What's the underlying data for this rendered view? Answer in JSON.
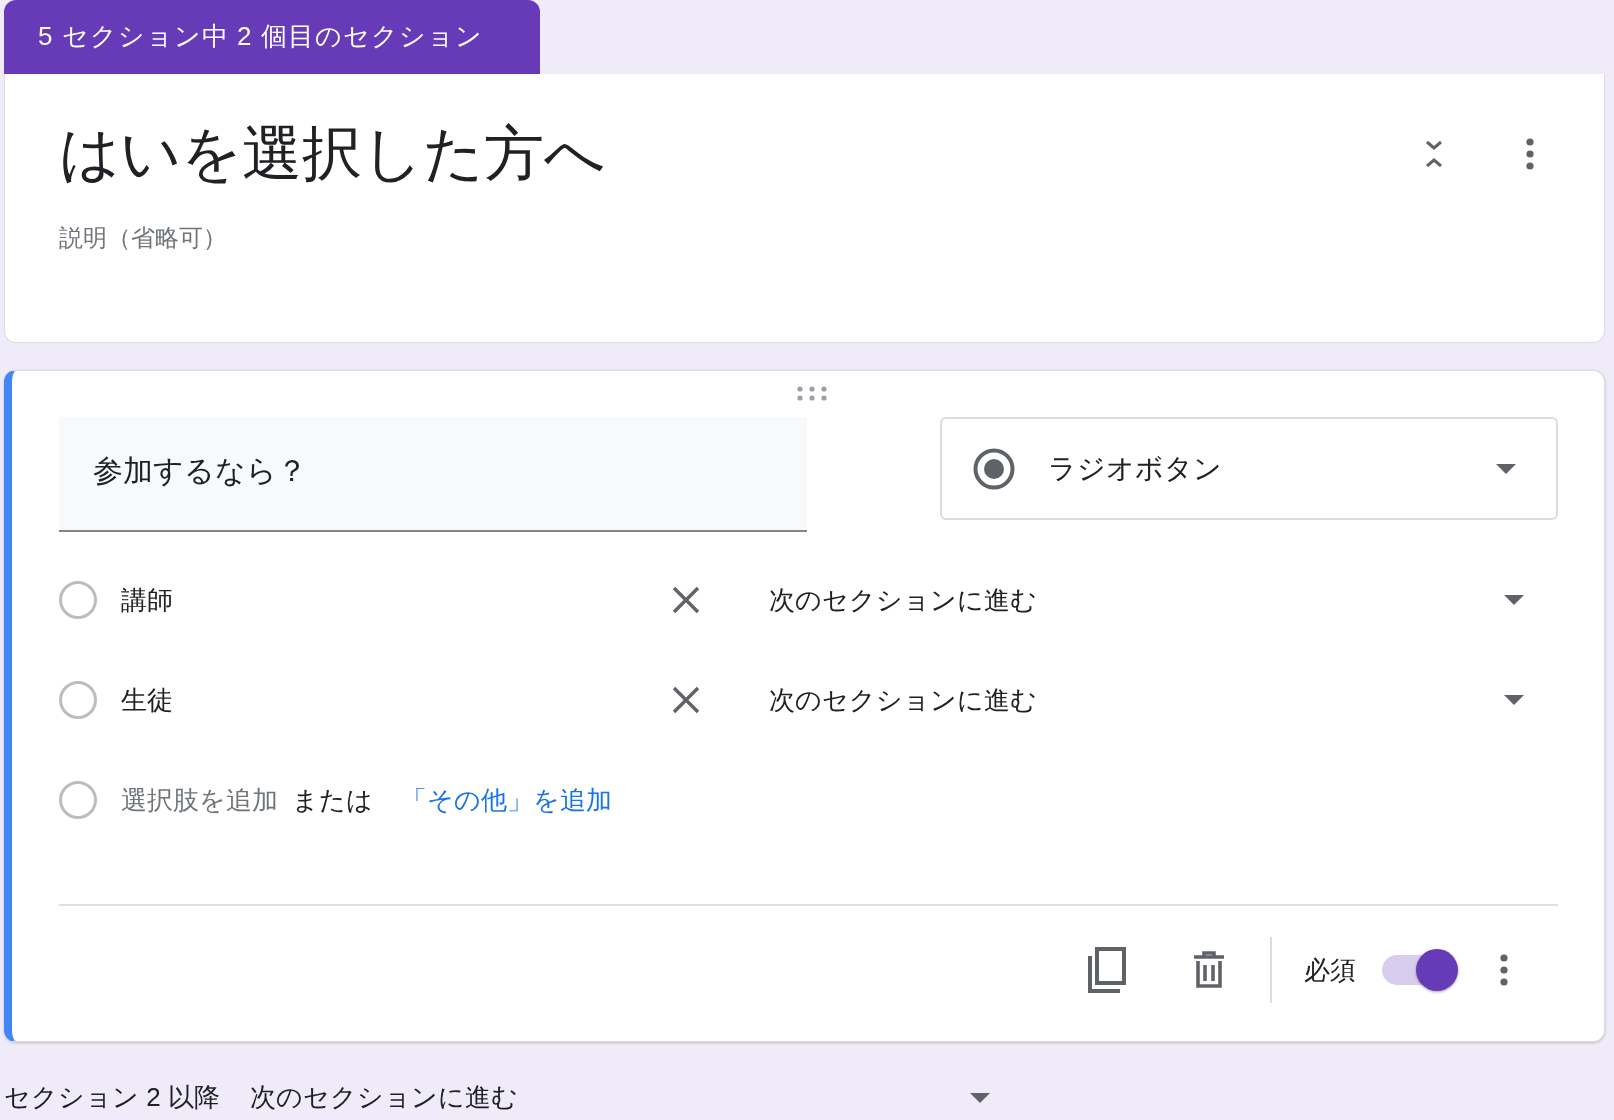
{
  "section_tab": "5 セクション中 2 個目のセクション",
  "section": {
    "title": "はいを選択した方へ",
    "description": {
      "placeholder": "説明（省略可）"
    }
  },
  "question": {
    "title": "参加するなら？",
    "type": "ラジオボタン",
    "options": [
      {
        "label": "講師",
        "go_to": "次のセクションに進む"
      },
      {
        "label": "生徒",
        "go_to": "次のセクションに進む"
      }
    ],
    "add_option": "選択肢を追加",
    "or": "または",
    "add_other": "「その他」を追加",
    "required_label": "必須",
    "required": true
  },
  "after_section": {
    "label": "セクション 2 以降",
    "go_to": "次のセクションに進む"
  }
}
